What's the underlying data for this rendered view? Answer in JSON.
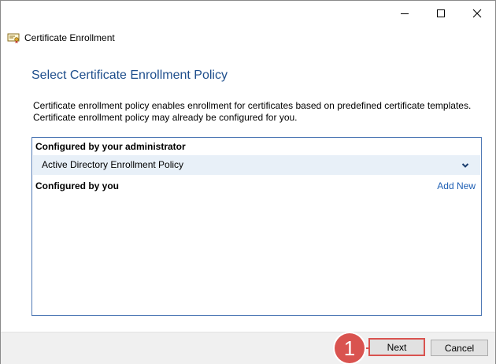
{
  "window": {
    "controls": {
      "minimize_icon": "minimize-icon",
      "maximize_icon": "maximize-icon",
      "close_icon": "close-icon"
    }
  },
  "app": {
    "title": "Certificate Enrollment",
    "icon": "certificate-icon"
  },
  "page": {
    "heading": "Select Certificate Enrollment Policy",
    "description_lines": [
      "Certificate enrollment policy enables enrollment for certificates based on predefined certificate templates.",
      "Certificate enrollment policy may already be configured for you."
    ]
  },
  "policy_box": {
    "admin_section_title": "Configured by your administrator",
    "admin_policy": "Active Directory Enrollment Policy",
    "user_section_title": "Configured by you",
    "add_new_label": "Add New"
  },
  "footer": {
    "next_label": "Next",
    "cancel_label": "Cancel"
  },
  "annotation": {
    "step_number": "1",
    "color": "#d9534f"
  },
  "colors": {
    "heading": "#1e4e8c",
    "link": "#1e5fb4",
    "box_border": "#4f79b5",
    "selected_row": "#e8f0f8",
    "footer_bg": "#f0f0f0"
  }
}
